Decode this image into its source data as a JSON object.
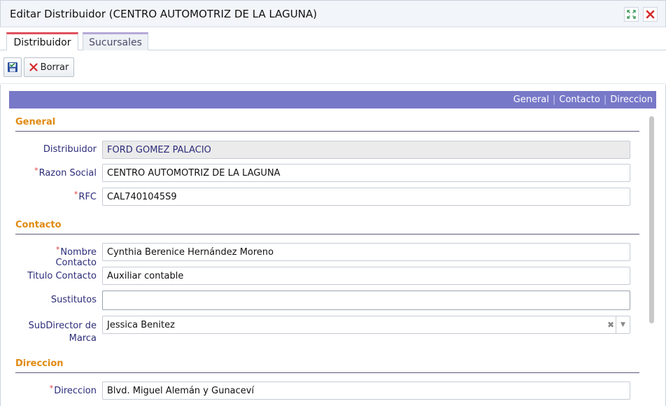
{
  "window": {
    "title": "Editar Distribuidor (CENTRO AUTOMOTRIZ DE LA LAGUNA)",
    "maximize_icon": "maximize-icon",
    "close_icon": "close-icon"
  },
  "tabs": [
    {
      "label": "Distribuidor",
      "active": true
    },
    {
      "label": "Sucursales",
      "active": false
    }
  ],
  "toolbar": {
    "save_icon": "save-icon",
    "delete_label": "Borrar",
    "delete_icon": "delete-x-icon"
  },
  "nav": {
    "links": [
      "General",
      "Contacto",
      "Direccion"
    ],
    "color": "#7878c8"
  },
  "sections": {
    "general": {
      "title": "General",
      "fields": {
        "distribuidor": {
          "label": "Distribuidor",
          "value": "FORD GOMEZ PALACIO",
          "required": false,
          "readonly": true
        },
        "razon_social": {
          "label": "Razon Social",
          "value": "CENTRO AUTOMOTRIZ DE LA LAGUNA",
          "required": true
        },
        "rfc": {
          "label": "RFC",
          "value": "CAL7401045S9",
          "required": true
        }
      }
    },
    "contacto": {
      "title": "Contacto",
      "fields": {
        "nombre_contacto": {
          "label": "Nombre Contacto",
          "value": "Cynthia Berenice Hernández Moreno",
          "required": true
        },
        "titulo_contacto": {
          "label": "Titulo Contacto",
          "value": "Auxiliar contable",
          "required": false
        },
        "sustitutos": {
          "label": "Sustitutos",
          "value": "",
          "required": false
        },
        "subdirector": {
          "label_line1": "SubDirector de",
          "label_line2": "Marca",
          "value": "Jessica Benitez",
          "required": false
        }
      }
    },
    "direccion": {
      "title": "Direccion",
      "fields": {
        "direccion": {
          "label": "Direccion",
          "value": "Blvd. Miguel Alemán y Gunaceví",
          "required": true
        }
      }
    }
  },
  "colors": {
    "section_title": "#e08a10",
    "label": "#2c2c7a",
    "required": "#e04040",
    "active_tab_accent": "#e0505d"
  }
}
